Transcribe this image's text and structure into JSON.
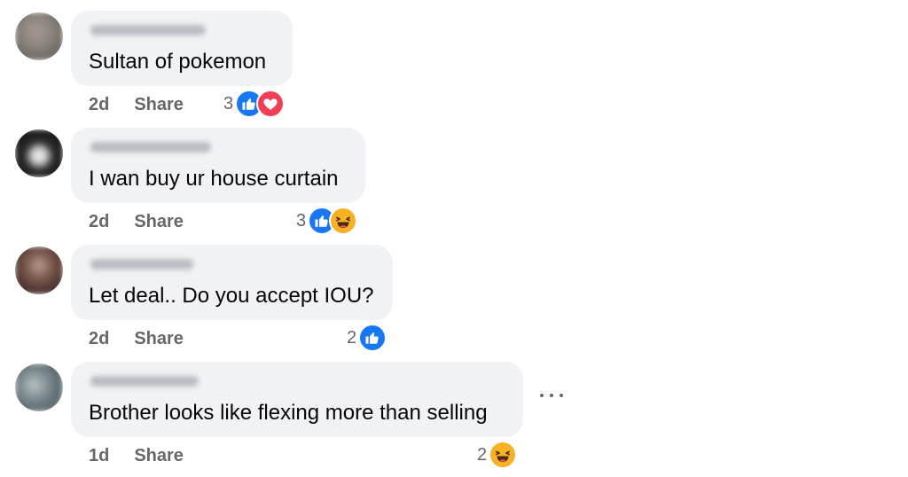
{
  "comments": [
    {
      "text": "Sultan of pokemon",
      "time": "2d",
      "share_label": "Share",
      "reaction_count": "3",
      "reactions": [
        "like-icon",
        "love-icon"
      ]
    },
    {
      "text": "I wan buy ur house curtain",
      "time": "2d",
      "share_label": "Share",
      "reaction_count": "3",
      "reactions": [
        "like-icon",
        "haha-icon"
      ]
    },
    {
      "text": "Let deal.. Do you accept IOU?",
      "time": "2d",
      "share_label": "Share",
      "reaction_count": "2",
      "reactions": [
        "like-icon"
      ]
    },
    {
      "text": "Brother looks like flexing more than selling",
      "time": "1d",
      "share_label": "Share",
      "reaction_count": "2",
      "reactions": [
        "haha-icon"
      ]
    }
  ],
  "more_options_icon": "more-horizontal-icon",
  "colors": {
    "bubble": "#f0f2f5",
    "meta_text": "#65676b",
    "like": "#1877f2",
    "love": "#f33e58",
    "haha": "#f7b125"
  }
}
